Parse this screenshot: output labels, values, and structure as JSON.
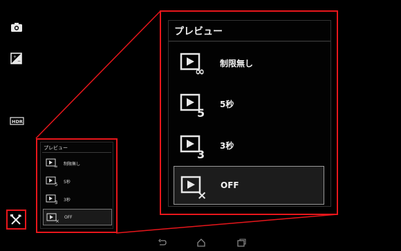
{
  "left_rail": {
    "icons": [
      "camera-icon",
      "exposure-icon",
      "hdr-icon",
      "tools-icon"
    ],
    "hdr_label": "HDR"
  },
  "preview_menu": {
    "title": "プレビュー",
    "options": [
      {
        "label": "制限無し",
        "icon": "preview-unlimited-icon",
        "badge": "∞"
      },
      {
        "label": "5秒",
        "icon": "preview-5s-icon",
        "badge": "5"
      },
      {
        "label": "3秒",
        "icon": "preview-3s-icon",
        "badge": "3"
      },
      {
        "label": "OFF",
        "icon": "preview-off-icon",
        "badge": "×"
      }
    ],
    "selected": "OFF"
  },
  "colors": {
    "highlight": "#e8161b",
    "background": "#000000"
  },
  "nav_bar": [
    "back-icon",
    "home-icon",
    "recent-apps-icon"
  ]
}
